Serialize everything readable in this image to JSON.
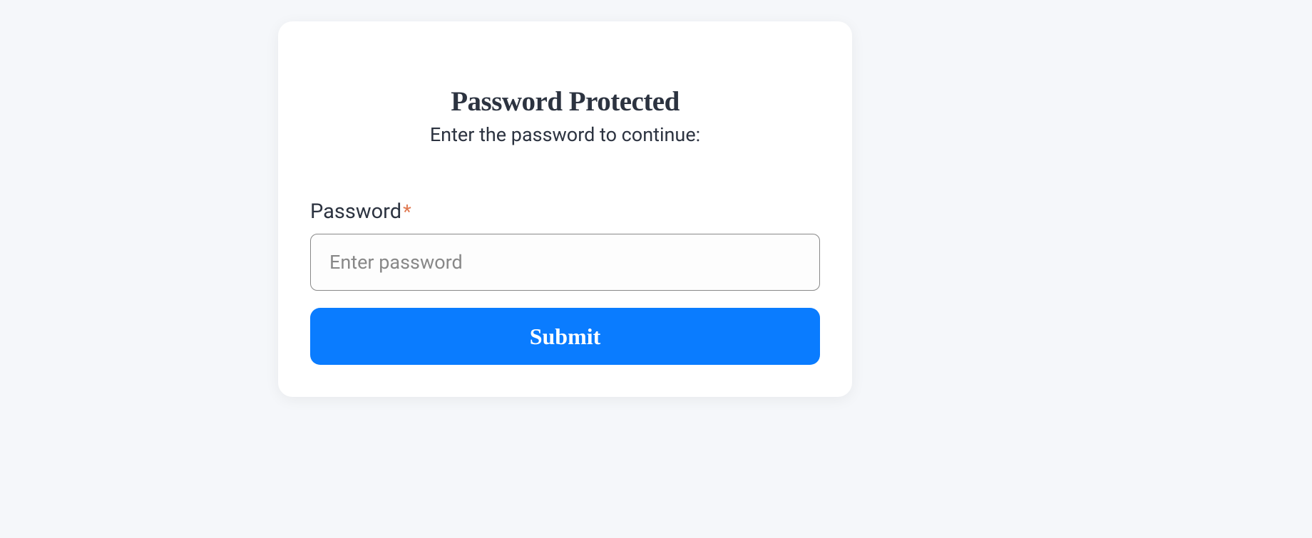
{
  "card": {
    "title": "Password Protected",
    "subtitle": "Enter the password to continue:",
    "field_label": "Password",
    "required_mark": "*",
    "input_placeholder": "Enter password",
    "input_value": "",
    "submit_label": "Submit"
  }
}
